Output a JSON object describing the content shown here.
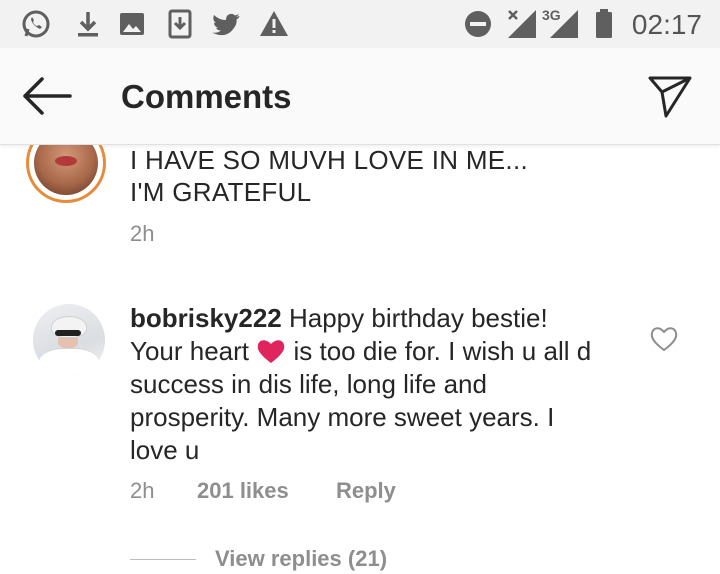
{
  "status_bar": {
    "time": "02:17",
    "icons": [
      "whatsapp-icon",
      "download-icon",
      "image-icon",
      "download-box-icon",
      "twitter-icon",
      "warning-icon",
      "do-not-disturb-icon",
      "signal-x-icon",
      "signal-3g-icon",
      "battery-icon"
    ],
    "network_label": "3G"
  },
  "app_bar": {
    "title": "Comments",
    "back_icon": "arrow-left-icon",
    "send_icon": "direct-send-icon"
  },
  "comments": [
    {
      "text_line1": "I HAVE SO MUVH LOVE IN ME...",
      "text_line2": "I'M GRATEFUL",
      "time": "2h"
    },
    {
      "username": "bobrisky222",
      "text_before_emoji": " Happy birthday bestie! Your heart ",
      "emoji": "red-heart-icon",
      "text_after_emoji": " is too die for. I wish u all d success in dis life, long life and prosperity. Many more sweet years. I love u",
      "time": "2h",
      "likes": "201 likes",
      "reply_label": "Reply",
      "view_replies": "View replies (21)"
    }
  ],
  "colors": {
    "text_primary": "#262626",
    "text_secondary": "#8e8e8e",
    "story_ring": "#e88a3a",
    "heart": "#e0245e"
  }
}
